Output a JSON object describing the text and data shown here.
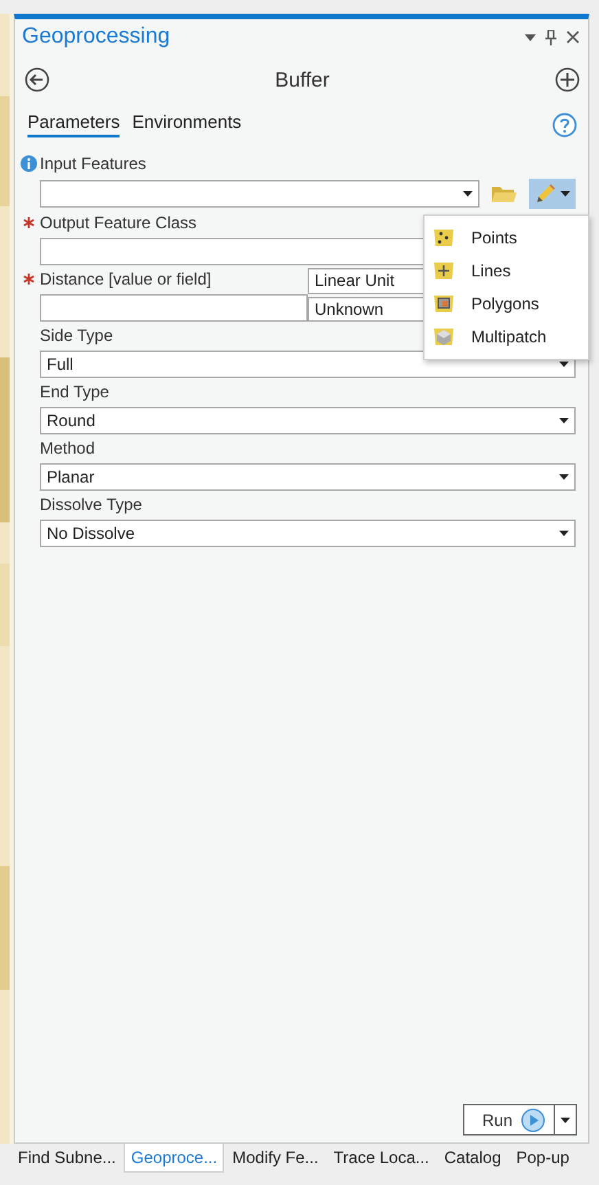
{
  "pane": {
    "title": "Geoprocessing"
  },
  "tool": {
    "title": "Buffer"
  },
  "tabs": [
    {
      "label": "Parameters",
      "selected": true
    },
    {
      "label": "Environments",
      "selected": false
    }
  ],
  "parameters": [
    {
      "kind": "input",
      "label": "Input Features",
      "required": false
    },
    {
      "kind": "output",
      "label": "Output Feature Class",
      "required": true
    },
    {
      "kind": "distance",
      "label": "Distance [value or field]",
      "required": true,
      "unit_type": "Linear Unit",
      "unit": "Unknown"
    },
    {
      "kind": "dropdown",
      "label": "Side Type",
      "required": false,
      "value": "Full"
    },
    {
      "kind": "dropdown",
      "label": "End Type",
      "required": false,
      "value": "Round"
    },
    {
      "kind": "dropdown",
      "label": "Method",
      "required": false,
      "value": "Planar"
    },
    {
      "kind": "dropdown",
      "label": "Dissolve Type",
      "required": false,
      "value": "No Dissolve"
    }
  ],
  "create_menu": {
    "items": [
      {
        "label": "Points"
      },
      {
        "label": "Lines"
      },
      {
        "label": "Polygons"
      },
      {
        "label": "Multipatch"
      }
    ]
  },
  "run_button": {
    "label": "Run"
  },
  "bottom_tabs": [
    {
      "label": "Find Subne...",
      "selected": false
    },
    {
      "label": "Geoproce...",
      "selected": true
    },
    {
      "label": "Modify Fe...",
      "selected": false
    },
    {
      "label": "Trace Loca...",
      "selected": false
    },
    {
      "label": "Catalog",
      "selected": false
    },
    {
      "label": "Pop-up",
      "selected": false
    }
  ]
}
